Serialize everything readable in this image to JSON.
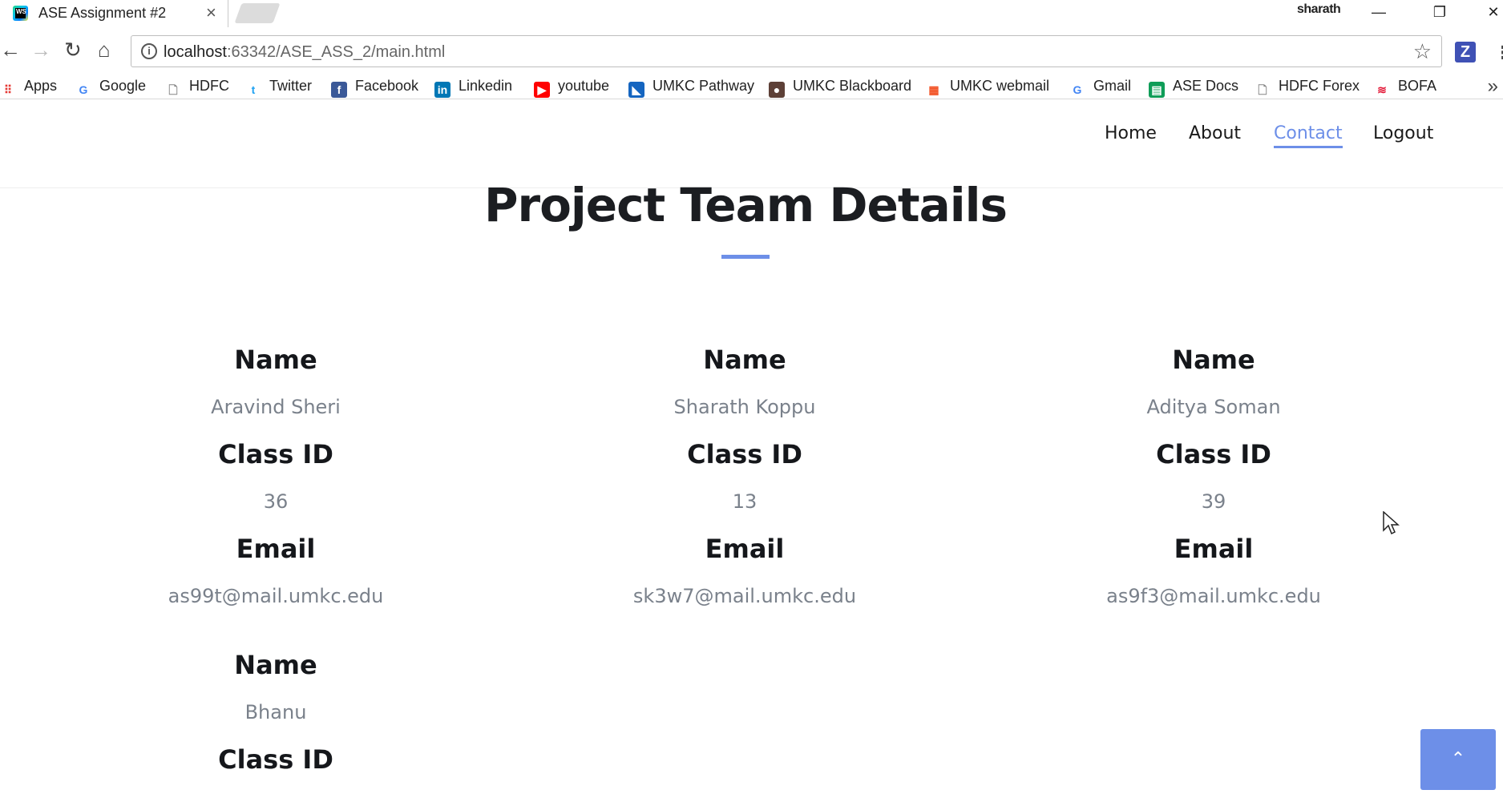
{
  "browser": {
    "tab_title": "ASE Assignment #2",
    "favicon_text": "WS",
    "profile_name": "sharath",
    "url_host": "localhost",
    "url_rest": ":63342/ASE_ASS_2/main.html",
    "extension_label": "Z",
    "bookmarks": [
      {
        "label": "Apps",
        "icon": "apps-grid-icon",
        "color": "#e53935"
      },
      {
        "label": "Google",
        "icon": "google-icon",
        "color": "#4285f4"
      },
      {
        "label": "HDFC",
        "icon": "page-icon",
        "color": "#888888"
      },
      {
        "label": "Twitter",
        "icon": "twitter-icon",
        "color": "#1da1f2"
      },
      {
        "label": "Facebook",
        "icon": "facebook-icon",
        "color": "#3b5998"
      },
      {
        "label": "Linkedin",
        "icon": "linkedin-icon",
        "color": "#0077b5"
      },
      {
        "label": "youtube",
        "icon": "youtube-icon",
        "color": "#ff0000"
      },
      {
        "label": "UMKC Pathway",
        "icon": "umkc-pathway-icon",
        "color": "#1565c0"
      },
      {
        "label": "UMKC Blackboard",
        "icon": "umkc-blackboard-icon",
        "color": "#5d4037"
      },
      {
        "label": "UMKC webmail",
        "icon": "microsoft-icon",
        "color": "#f25022"
      },
      {
        "label": "Gmail",
        "icon": "google-icon",
        "color": "#4285f4"
      },
      {
        "label": "ASE Docs",
        "icon": "sheets-icon",
        "color": "#0f9d58"
      },
      {
        "label": "HDFC Forex",
        "icon": "page-icon",
        "color": "#888888"
      },
      {
        "label": "BOFA",
        "icon": "bofa-icon",
        "color": "#e31837"
      }
    ]
  },
  "nav": {
    "links": [
      "Home",
      "About",
      "Contact",
      "Logout"
    ],
    "active": "Contact"
  },
  "page": {
    "title": "Project Team Details",
    "accent_color": "#6d8fe8"
  },
  "labels": {
    "name": "Name",
    "class_id": "Class ID",
    "email": "Email"
  },
  "members": [
    {
      "name": "Aravind Sheri",
      "class_id": "36",
      "email": "as99t@mail.umkc.edu"
    },
    {
      "name": "Sharath Koppu",
      "class_id": "13",
      "email": "sk3w7@mail.umkc.edu"
    },
    {
      "name": "Aditya Soman",
      "class_id": "39",
      "email": "as9f3@mail.umkc.edu"
    },
    {
      "name": "Bhanu"
    }
  ],
  "back_to_top_icon": "chevron-up-icon"
}
